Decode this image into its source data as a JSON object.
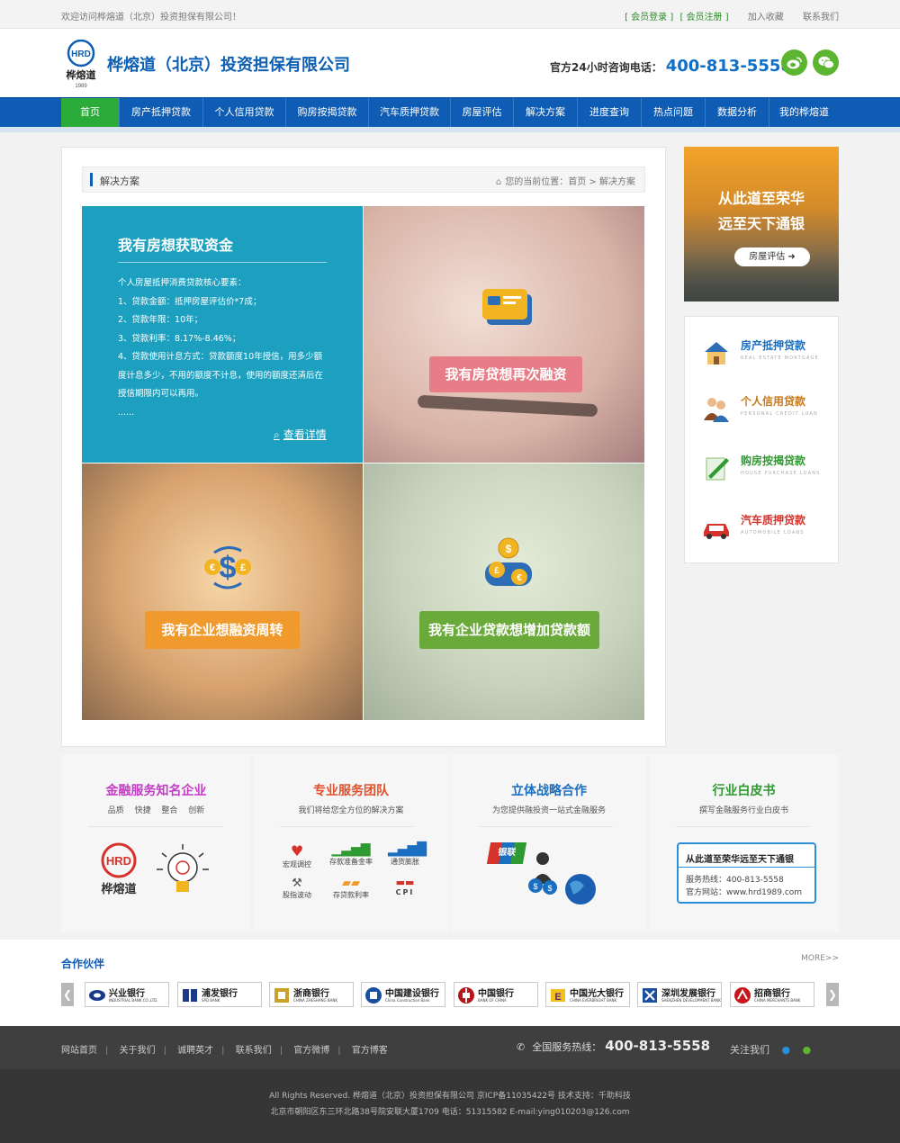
{
  "topbar": {
    "welcome": "欢迎访问桦熔道（北京）投资担保有限公司！",
    "login": "[ 会员登录 ]",
    "register": "[ 会员注册 ]",
    "favorite": "加入收藏",
    "contact": "联系我们"
  },
  "header": {
    "logo_text": "桦熔道",
    "logo_abbr": "HRD",
    "logo_year": "1989",
    "company": "桦熔道（北京）投资担保有限公司",
    "hotline_label": "官方24小时咨询电话：",
    "hotline_number": "400-813-5558"
  },
  "nav": {
    "items": [
      "首页",
      "房产抵押贷款",
      "个人信用贷款",
      "购房按揭贷款",
      "汽车质押贷款",
      "房屋评估",
      "解决方案",
      "进度查询",
      "热点问题",
      "数据分析",
      "我的桦熔道"
    ]
  },
  "crumb": {
    "title": "解决方案",
    "position": "您的当前位置：首页 > 解决方案"
  },
  "tiles": {
    "t1": {
      "heading": "我有房想获取资金",
      "lines": [
        "个人房屋抵押消费贷款核心要素：",
        "1、贷款金额：抵押房屋评估价*7成；",
        "2、贷款年限：10年；",
        "3、贷款利率：8.17%-8.46%；",
        "4、贷款使用计息方式：贷款额度10年授信，用多少额",
        "度计息多少，不用的额度不计息，使用的额度还清后在",
        "授信期限内可以再用。",
        "......"
      ],
      "more": "查看详情"
    },
    "t2": {
      "label": "我有房贷想再次融资",
      "color": "#e87d87"
    },
    "t3": {
      "label": "我有企业想融资周转",
      "color": "#f09a2e"
    },
    "t4": {
      "label": "我有企业贷款想增加贷款额",
      "color": "#6aaa3a"
    }
  },
  "right_banner": {
    "line1": "从此道至荣华",
    "line2": "远至天下通银",
    "button": "房屋评估"
  },
  "right_menu": [
    {
      "title": "房产抵押贷款",
      "en": "REAL ESTATE MORTGAGE",
      "color": "#1a6fc0",
      "icon": "house-icon"
    },
    {
      "title": "个人信用贷款",
      "en": "PERSONAL CREDIT LOAN",
      "color": "#c77a1a",
      "icon": "people-icon"
    },
    {
      "title": "购房按揭贷款",
      "en": "HOUSE PURCHASE LOANS",
      "color": "#2f9a32",
      "icon": "pen-icon"
    },
    {
      "title": "汽车质押贷款",
      "en": "AUTOMOBILE LOANS",
      "color": "#d6322c",
      "icon": "car-icon"
    }
  ],
  "features": [
    {
      "title": "金融服务知名企业",
      "sub": "品质　 快捷　 整合　 创新",
      "color": "#c23cc6"
    },
    {
      "title": "专业服务团队",
      "sub": "我们将给您全方位的解决方案",
      "color": "#e0502b"
    },
    {
      "title": "立体战略合作",
      "sub": "为您提供融投资一站式金融服务",
      "color": "#1a6fc0"
    },
    {
      "title": "行业白皮书",
      "sub": "撰写金融服务行业白皮书",
      "color": "#2f9a32"
    }
  ],
  "team_icons": [
    "宏观调控",
    "存款准备金率",
    "通货膨胀",
    "股指波动",
    "存贷款利率",
    "CPI"
  ],
  "whitepaper": {
    "title": "从此道至荣华远至天下通银",
    "line1": "服务热线：400-813-5558",
    "line2": "官方网站：www.hrd1989.com"
  },
  "unionpay": "银联",
  "partners": {
    "title": "合作伙伴",
    "more": "MORE>>",
    "banks": [
      {
        "name": "兴业银行",
        "en": "INDUSTRIAL BANK CO.,LTD."
      },
      {
        "name": "浦发银行",
        "en": "SPD BANK"
      },
      {
        "name": "浙商银行",
        "en": "CHINA ZHESHANG BANK"
      },
      {
        "name": "中国建设银行",
        "en": "China Construction Bank"
      },
      {
        "name": "中国银行",
        "en": "BANK OF CHINA"
      },
      {
        "name": "中国光大银行",
        "en": "CHINA EVERBRIGHT BANK"
      },
      {
        "name": "深圳发展银行",
        "en": "SHENZHEN DEVELOPMENT BANK"
      },
      {
        "name": "招商银行",
        "en": "CHINA MERCHANTS BANK"
      }
    ]
  },
  "footer": {
    "links": [
      "网站首页",
      "关于我们",
      "诚聘英才",
      "联系我们",
      "官方微博",
      "官方博客"
    ],
    "hotline_label": "全国服务热线：",
    "hotline": "400-813-5558",
    "follow": "关注我们",
    "copyright": "All Rights Reserved.  桦熔道（北京）投资担保有限公司    京ICP备11035422号   技术支持：千助科技",
    "address": "北京市朝阳区东三环北路38号院安联大厦1709    电话：51315582   E-mail:ying010203@126.com"
  }
}
